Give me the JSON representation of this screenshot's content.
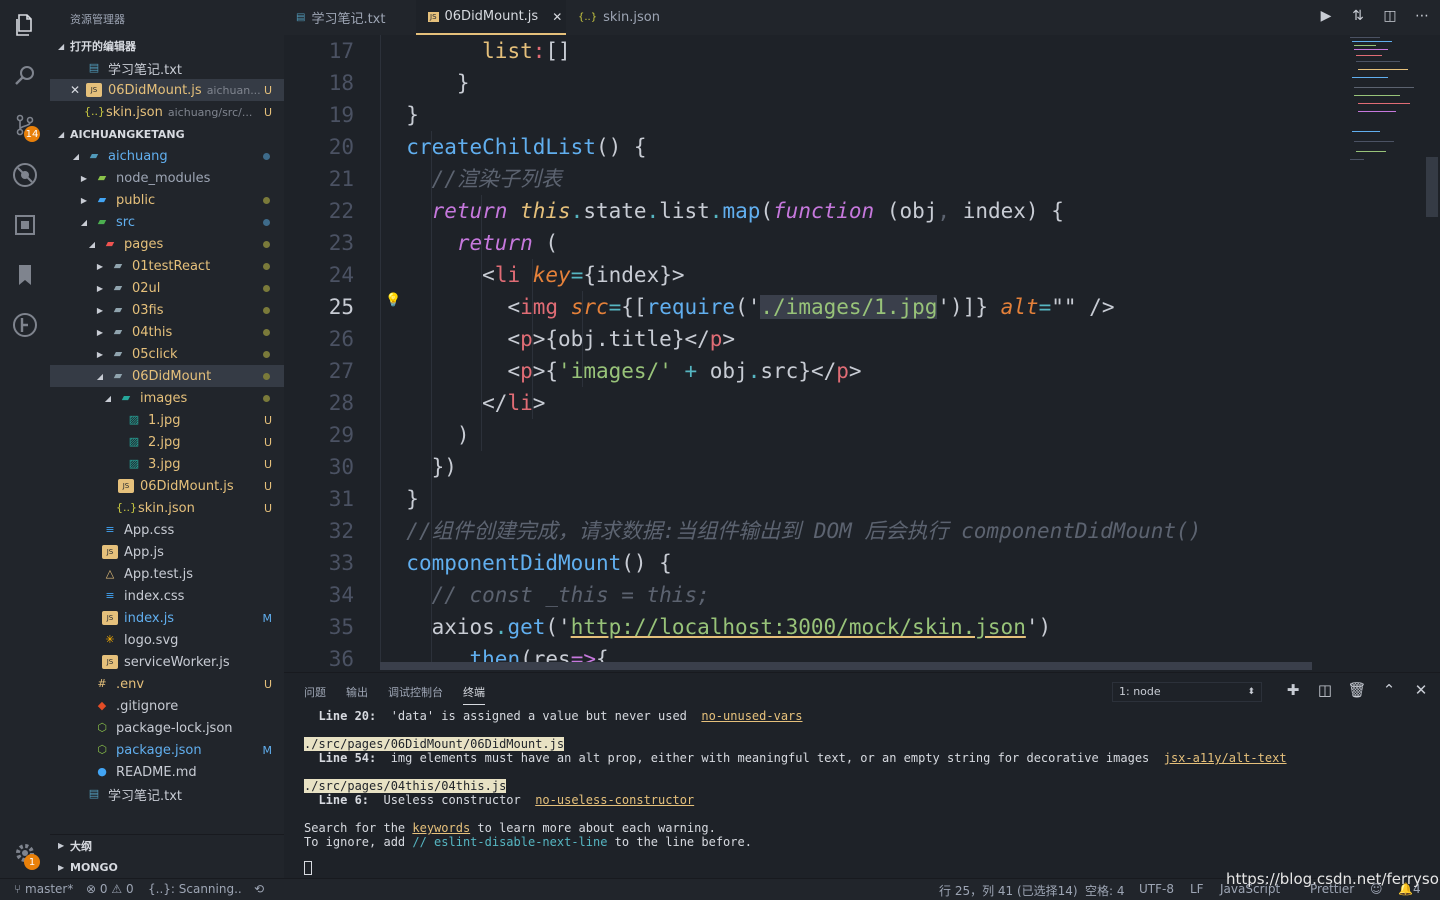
{
  "activity": {
    "scm_badge": "14",
    "settings_badge": "1"
  },
  "sidebar": {
    "title": "资源管理器",
    "open_editors": {
      "header": "打开的编辑器",
      "items": [
        {
          "name": "学习笔记.txt",
          "sub": "",
          "mark": ""
        },
        {
          "name": "06DidMount.js",
          "sub": "aichuan...",
          "mark": "U"
        },
        {
          "name": "skin.json",
          "sub": "aichuang/src/...",
          "mark": "U"
        }
      ]
    },
    "project": {
      "header": "AICHUANGKETANG",
      "items": [
        {
          "name": "aichuang"
        },
        {
          "name": "node_modules"
        },
        {
          "name": "public"
        },
        {
          "name": "src"
        },
        {
          "name": "pages"
        },
        {
          "name": "01testReact"
        },
        {
          "name": "02ul"
        },
        {
          "name": "03fis"
        },
        {
          "name": "04this"
        },
        {
          "name": "05click"
        },
        {
          "name": "06DidMount"
        },
        {
          "name": "images"
        },
        {
          "name": "1.jpg",
          "mark": "U"
        },
        {
          "name": "2.jpg",
          "mark": "U"
        },
        {
          "name": "3.jpg",
          "mark": "U"
        },
        {
          "name": "06DidMount.js",
          "mark": "U"
        },
        {
          "name": "skin.json",
          "mark": "U"
        },
        {
          "name": "App.css"
        },
        {
          "name": "App.js"
        },
        {
          "name": "App.test.js"
        },
        {
          "name": "index.css"
        },
        {
          "name": "index.js",
          "mark": "M"
        },
        {
          "name": "logo.svg"
        },
        {
          "name": "serviceWorker.js"
        },
        {
          "name": ".env",
          "mark": "U"
        },
        {
          "name": ".gitignore"
        },
        {
          "name": "package-lock.json"
        },
        {
          "name": "package.json",
          "mark": "M"
        },
        {
          "name": "README.md"
        },
        {
          "name": "学习笔记.txt"
        }
      ]
    },
    "outline_header": "大纲",
    "mongo_header": "MONGO"
  },
  "tabs": [
    {
      "label": "学习笔记.txt"
    },
    {
      "label": "06DidMount.js",
      "close": "✕"
    },
    {
      "label": "skin.json"
    }
  ],
  "editor": {
    "line_numbers": [
      "17",
      "18",
      "19",
      "20",
      "21",
      "22",
      "23",
      "24",
      "25",
      "26",
      "27",
      "28",
      "29",
      "30",
      "31",
      "32",
      "33",
      "34",
      "35",
      "36"
    ],
    "current_line": "25",
    "code": {
      "l17": {
        "a": "list",
        "b": ":",
        "c": "[]"
      },
      "l18": "}",
      "l19": "}",
      "l20": {
        "fn": "createChildList",
        "rest": "() {"
      },
      "l21": "//渲染子列表",
      "l22": {
        "ret": "return",
        "this": "this",
        "d1": ".",
        "state": "state",
        "d2": ".",
        "list": "list",
        "d3": ".",
        "map": "map",
        "p": "(",
        "function": "function",
        "args": " (obj",
        "comma": ",",
        "args2": " index) {"
      },
      "l23": {
        "ret": "return",
        "rest": " ("
      },
      "l24": {
        "lt": "<",
        "tag": "li",
        "attr": "key",
        "eq": "=",
        "rest": "{index}>"
      },
      "l25": {
        "lt": "<",
        "tag": "img",
        "attr": "src",
        "eq": "=",
        "b1": "{[",
        "req": "require",
        "p1": "('",
        "path": "./images/1.jpg",
        "p2": "')]}",
        "alt": "alt",
        "eq2": "=",
        "str": "\"\"",
        "end": " />"
      },
      "l26": {
        "lt": "<",
        "tag": "p",
        "mid": ">{obj.title}</",
        "tag2": "p",
        "gt": ">"
      },
      "l27": {
        "lt": "<",
        "tag": "p",
        "mid": ">{",
        "str": "'images/'",
        "plus": " + ",
        "obj": "obj",
        "dot": ".",
        "src": "src",
        "rest": "}</",
        "tag2": "p",
        "gt": ">"
      },
      "l28": {
        "lt": "</",
        "tag": "li",
        "gt": ">"
      },
      "l29": ")",
      "l30": "})",
      "l31": "}",
      "l32": "//组件创建完成，请求数据:当组件输出到 DOM 后会执行 componentDidMount()",
      "l33": {
        "fn": "componentDidMount",
        "rest": "() {"
      },
      "l34": "// const _this = this;",
      "l35": {
        "ax": "axios",
        "dot": ".",
        "get": "get",
        "p1": "('",
        "url": "http://localhost:3000/mock/skin.json",
        "p2": "')"
      },
      "l36": {
        "dot": ".",
        "then": "then",
        "p": "(",
        "res": "res",
        "arrow": "=>",
        "b": "{"
      }
    }
  },
  "panel": {
    "tabs": [
      "问题",
      "输出",
      "调试控制台",
      "终端"
    ],
    "terminal_select": "1: node",
    "lines": {
      "t1_label": "Line 20:",
      "t1_msg": "  'data' is assigned a value but never used  ",
      "t1_rule": "no-unused-vars",
      "t2_path": "./src/pages/06DidMount/06DidMount.js",
      "t3_label": "Line 54:",
      "t3_msg": "  img elements must have an alt prop, either with meaningful text, or an empty string for decorative images  ",
      "t3_rule": "jsx-a11y/alt-text",
      "t4_path": "./src/pages/04this/04this.js",
      "t5_label": "Line 6:",
      "t5_msg": "  Useless constructor  ",
      "t5_rule": "no-useless-constructor",
      "t6_a": "Search for the ",
      "t6_kw": "keywords",
      "t6_b": " to learn more about each warning.",
      "t7_a": "To ignore, add ",
      "t7_cm": "// eslint-disable-next-line",
      "t7_b": " to the line before."
    }
  },
  "status": {
    "branch": "master*",
    "errors": "0",
    "warnings": "0",
    "scanning": "{..}: Scanning..",
    "position": "行 25，列 41 (已选择14)",
    "spaces": "空格: 4",
    "encoding": "UTF-8",
    "eol": "LF",
    "language": "JavaScript",
    "formatter": "Prettier",
    "bell_count": "4"
  },
  "watermark": "https://blog.csdn.net/ferrysoul"
}
